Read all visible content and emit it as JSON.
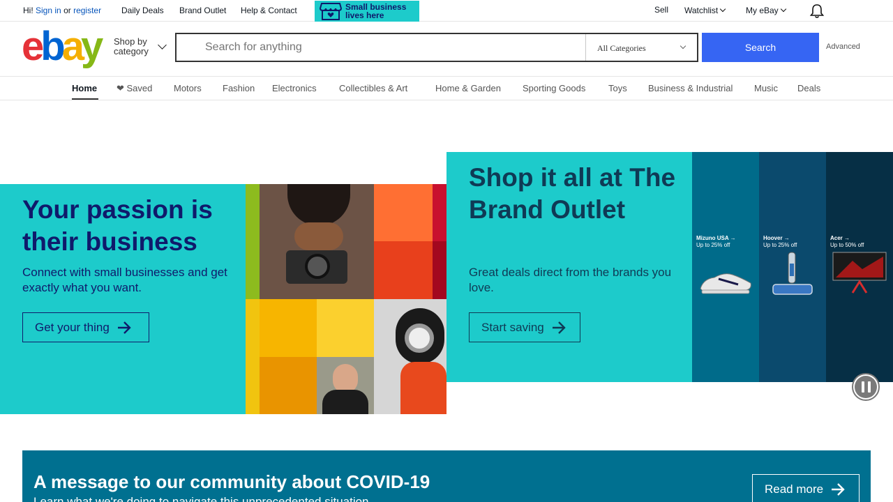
{
  "topbar": {
    "greeting": "Hi!",
    "sign_in": "Sign in",
    "or": "or",
    "register": "register",
    "daily_deals": "Daily Deals",
    "brand_outlet": "Brand Outlet",
    "help_contact": "Help & Contact",
    "promo_text_line1": "Small business",
    "promo_text_line2": "lives here",
    "sell": "Sell",
    "watchlist": "Watchlist",
    "my_ebay": "My eBay",
    "notification_icon": "bell-icon"
  },
  "header": {
    "logo": {
      "e": "e",
      "b": "b",
      "a": "a",
      "y": "y"
    },
    "shop_by_line1": "Shop by",
    "shop_by_line2": "category",
    "search_placeholder": "Search for anything",
    "category_selected": "All Categories",
    "search_button": "Search",
    "advanced": "Advanced"
  },
  "nav": {
    "tabs": [
      {
        "label": "Home",
        "active": true
      },
      {
        "label": "❤ Saved"
      },
      {
        "label": "Motors"
      },
      {
        "label": "Fashion"
      },
      {
        "label": "Electronics"
      },
      {
        "label": "Collectibles & Art"
      },
      {
        "label": "Home & Garden"
      },
      {
        "label": "Sporting Goods"
      },
      {
        "label": "Toys"
      },
      {
        "label": "Business & Industrial"
      },
      {
        "label": "Music"
      },
      {
        "label": "Deals"
      }
    ]
  },
  "hero_left": {
    "title": "Your passion is their business",
    "subtitle": "Connect with small businesses and get exactly what you want.",
    "cta": "Get your thing"
  },
  "hero_right": {
    "title": "Shop it all at The Brand Outlet",
    "subtitle": "Great deals direct from the brands you love.",
    "cta": "Start saving",
    "brands": [
      {
        "name": "Mizuno USA →",
        "offer": "Up to 25% off",
        "color": "#006b8a"
      },
      {
        "name": "Hoover →",
        "offer": "Up to 25% off",
        "color": "#0b4a6d"
      },
      {
        "name": "Acer →",
        "offer": "Up to 50% off",
        "color": "#062f45"
      }
    ]
  },
  "covid": {
    "title": "A message to our community about COVID-19",
    "subtitle": "Learn what we're doing to navigate this unprecedented situation.",
    "cta": "Read more"
  },
  "colors": {
    "accent": "#3665f3",
    "hero_bg": "#1dcbcb",
    "covid_bg": "#007090"
  }
}
